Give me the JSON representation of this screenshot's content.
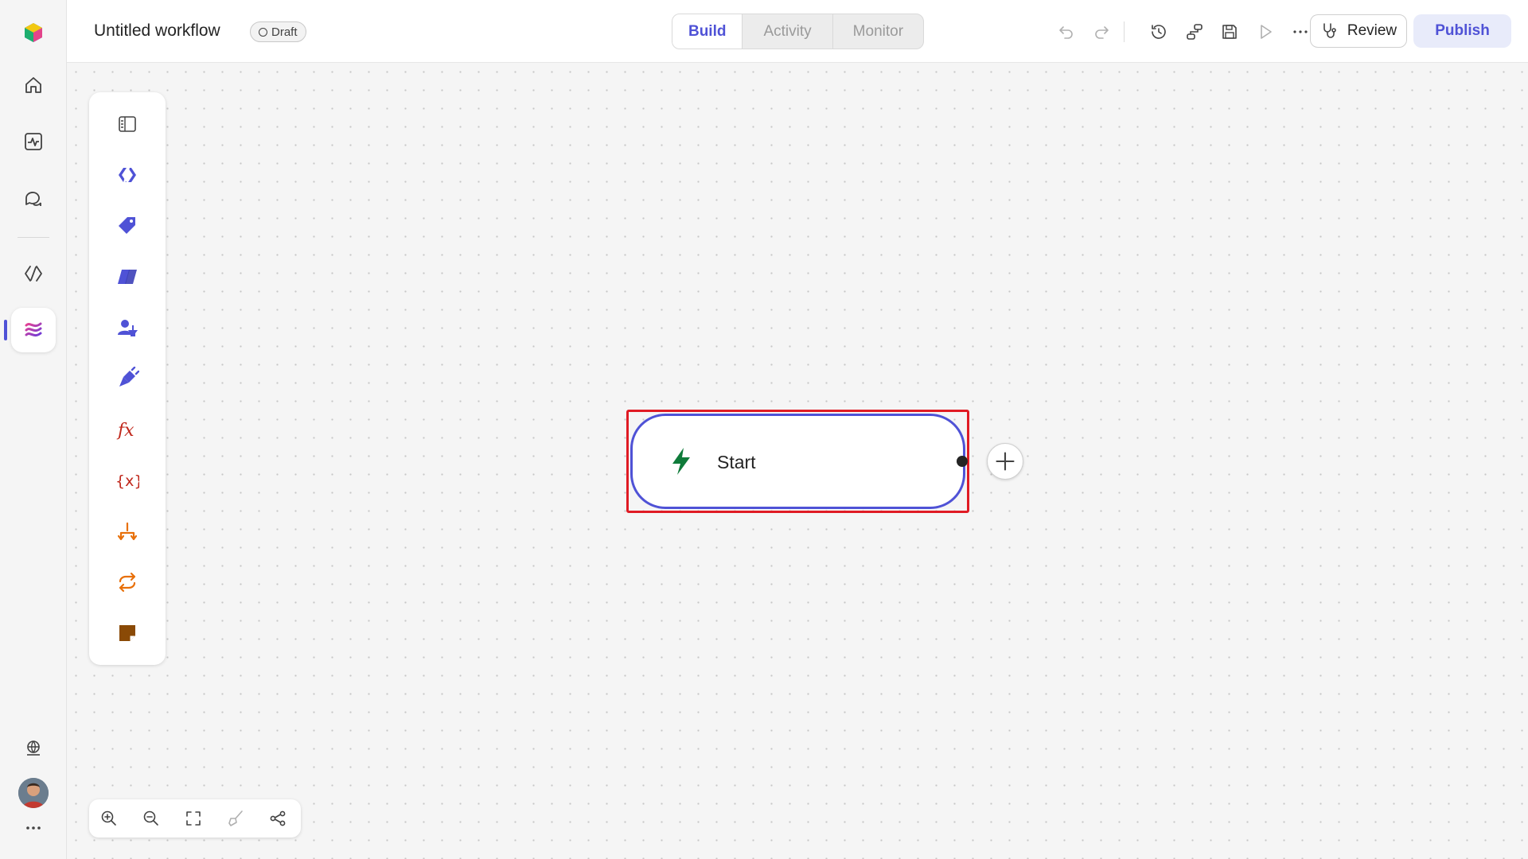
{
  "app": {
    "workflow_title": "Untitled workflow",
    "status_badge": "Draft"
  },
  "rail": {
    "items": [
      {
        "name": "home-icon"
      },
      {
        "name": "activity-icon"
      },
      {
        "name": "chat-icon"
      },
      {
        "name": "code-icon"
      },
      {
        "name": "workflows-icon",
        "active": true
      }
    ],
    "bottom": [
      {
        "name": "globe-icon"
      },
      {
        "name": "avatar"
      },
      {
        "name": "more-icon"
      }
    ]
  },
  "tabs": [
    {
      "label": "Build",
      "active": true
    },
    {
      "label": "Activity"
    },
    {
      "label": "Monitor"
    }
  ],
  "toolbar": {
    "icons": [
      "undo-icon",
      "redo-icon",
      "history-icon",
      "connections-icon",
      "save-icon",
      "run-icon",
      "more-icon"
    ],
    "review_label": "Review",
    "publish_label": "Publish"
  },
  "palette": {
    "items": [
      {
        "name": "toggle-panel-icon"
      },
      {
        "name": "code-action-icon",
        "color": "#4f52d6"
      },
      {
        "name": "tag-icon",
        "color": "#4f52d6"
      },
      {
        "name": "copilot-icon",
        "color": "#4f52d6"
      },
      {
        "name": "user-approval-icon",
        "color": "#4f52d6"
      },
      {
        "name": "connector-plug-icon",
        "color": "#4f52d6"
      },
      {
        "name": "function-fx-icon",
        "color": "#c0281c"
      },
      {
        "name": "variable-icon",
        "color": "#c0281c"
      },
      {
        "name": "branch-icon",
        "color": "#e8700a"
      },
      {
        "name": "loop-icon",
        "color": "#e8700a"
      },
      {
        "name": "note-icon",
        "color": "#8a4a06"
      }
    ]
  },
  "canvas": {
    "start_node_label": "Start",
    "start_icon_color": "#0f7b3a",
    "accent": "#4f52d6",
    "highlight_color": "#e01b24"
  },
  "zoom_controls": [
    "zoom-in-icon",
    "zoom-out-icon",
    "fit-screen-icon",
    "tidy-brush-icon",
    "auto-layout-icon"
  ]
}
